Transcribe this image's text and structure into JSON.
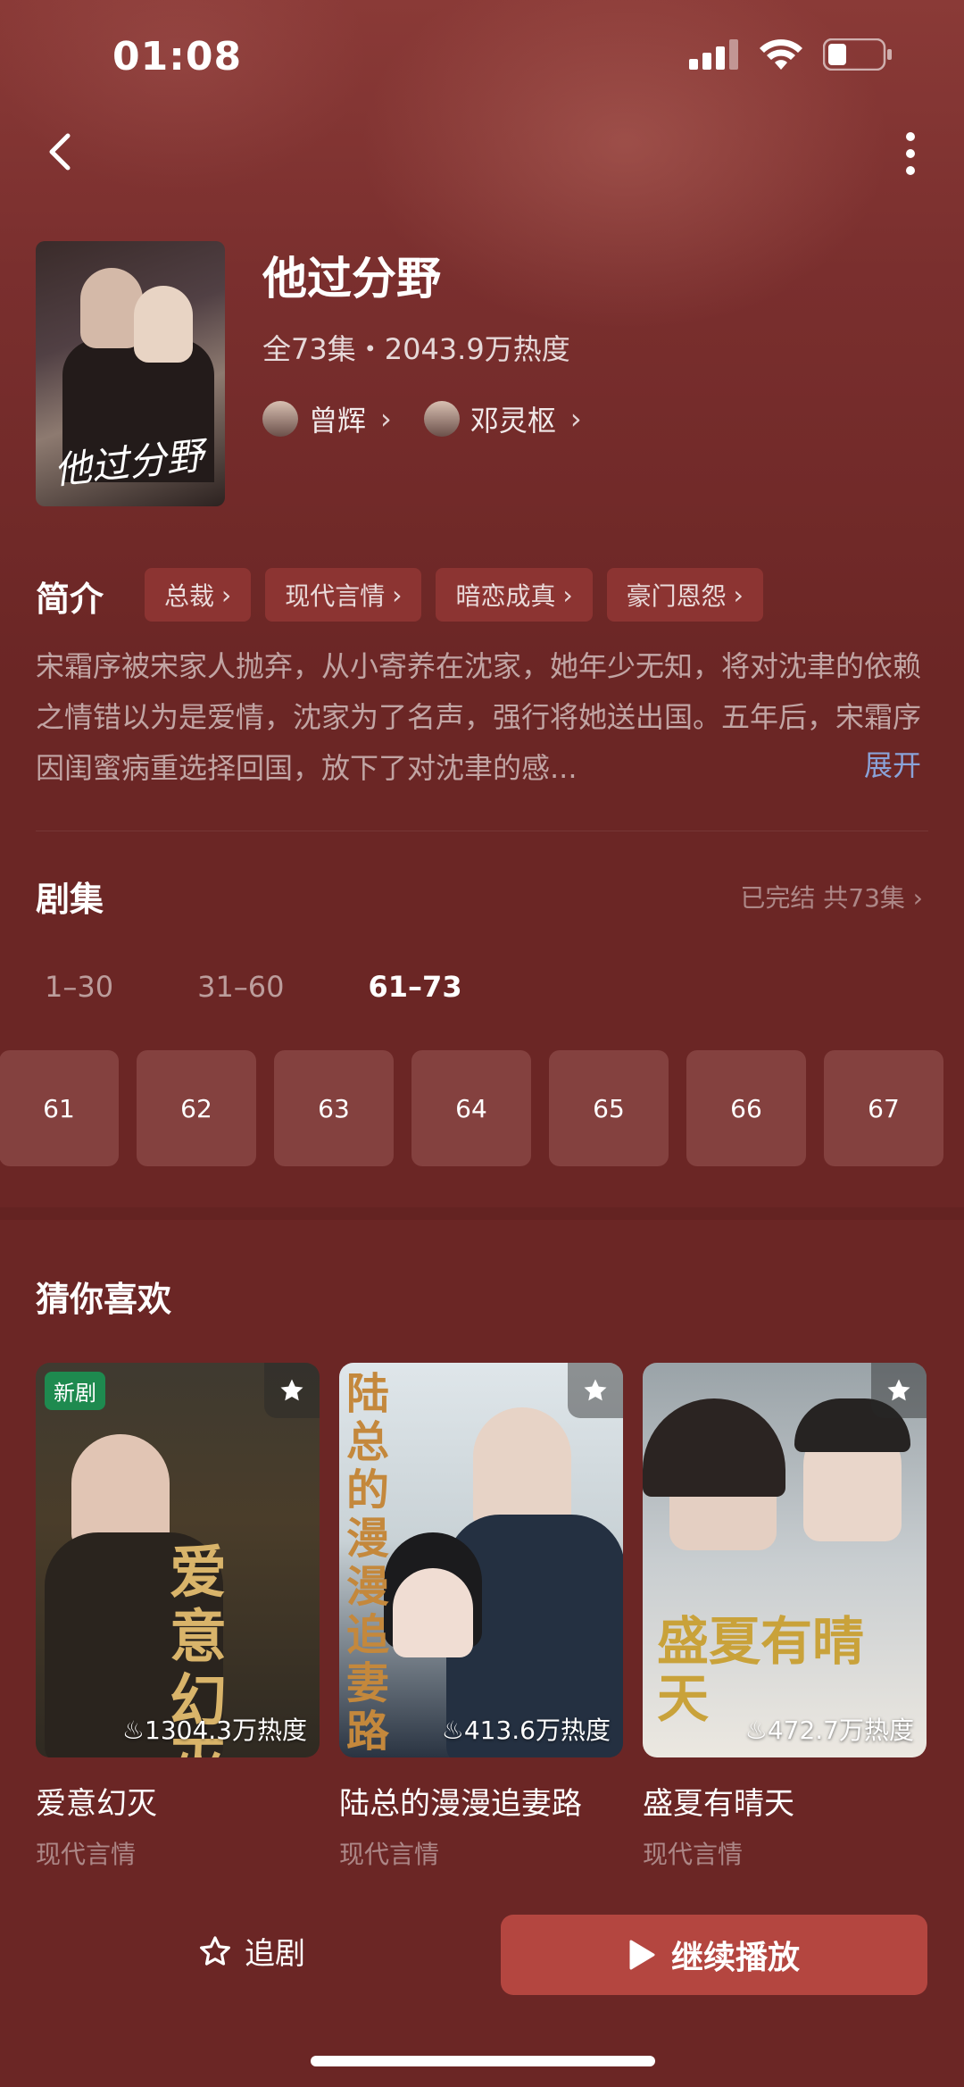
{
  "status_bar": {
    "time": "01:08"
  },
  "drama": {
    "title": "他过分野",
    "meta": "全73集・2043.9万热度",
    "poster_text": "他过分野",
    "actors": [
      {
        "name": "曾辉"
      },
      {
        "name": "邓灵枢"
      }
    ]
  },
  "intro": {
    "label": "简介",
    "tags": [
      "总裁",
      "现代言情",
      "暗恋成真",
      "豪门恩怨"
    ],
    "synopsis": "宋霜序被宋家人抛弃，从小寄养在沈家，她年少无知，将对沈聿的依赖之情错以为是爱情，沈家为了名声，强行将她送出国。五年后，宋霜序因闺蜜病重选择回国，放下了对沈聿的感...",
    "expand": "展开"
  },
  "episodes": {
    "title": "剧集",
    "status": "已完结 共73集",
    "ranges": [
      "1–30",
      "31–60",
      "61–73"
    ],
    "active_range": "61–73",
    "items": [
      "61",
      "62",
      "63",
      "64",
      "65",
      "66",
      "67"
    ]
  },
  "recommend": {
    "title": "猜你喜欢",
    "items": [
      {
        "name": "爱意幻灭",
        "genre": "现代言情",
        "heat": "1304.3万热度",
        "badge": "新剧",
        "poster_text": "爱意幻灭"
      },
      {
        "name": "陆总的漫漫追妻路",
        "genre": "现代言情",
        "heat": "413.6万热度",
        "poster_text": "陆总的漫漫追妻路"
      },
      {
        "name": "盛夏有晴天",
        "genre": "现代言情",
        "heat": "472.7万热度",
        "poster_text": "盛夏有晴天"
      }
    ]
  },
  "bottom_bar": {
    "follow_label": "追剧",
    "play_label": "继续播放"
  },
  "colors": {
    "background": "#6b2625",
    "tag_bg": "#8c3432",
    "play_button": "#b44640",
    "expand_link": "#8aa2d8",
    "new_badge": "#1e8a4f"
  }
}
